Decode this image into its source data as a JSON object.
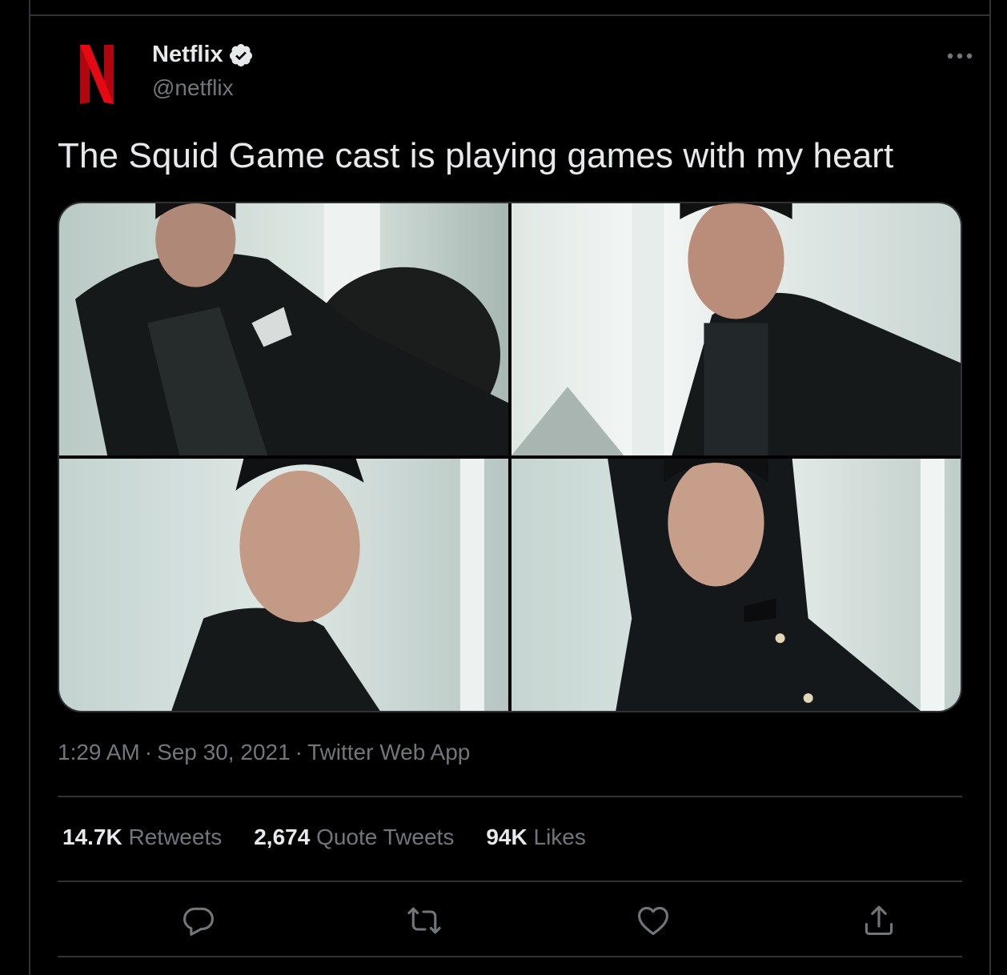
{
  "tweet": {
    "author": {
      "display_name": "Netflix",
      "handle": "@netflix",
      "verified": true,
      "avatar_icon": "netflix-n-logo",
      "brand_color": "#e50914"
    },
    "text": "The Squid Game cast is playing games with my heart",
    "media": [
      {
        "alt": "Cast member in dark suit with pocket square leaning on chair"
      },
      {
        "alt": "Cast member in black suit by window"
      },
      {
        "alt": "Cast member in dark jacket leaning on wall"
      },
      {
        "alt": "Cast member in black jacket with bow"
      }
    ],
    "meta": {
      "time": "1:29 AM",
      "separator": "·",
      "date": "Sep 30, 2021",
      "source": "Twitter Web App"
    },
    "stats": {
      "retweets": {
        "count": "14.7K",
        "label": "Retweets"
      },
      "quotes": {
        "count": "2,674",
        "label": "Quote Tweets"
      },
      "likes": {
        "count": "94K",
        "label": "Likes"
      }
    },
    "actions": {
      "reply_icon": "reply-icon",
      "retweet_icon": "retweet-icon",
      "like_icon": "heart-icon",
      "share_icon": "share-icon"
    }
  },
  "colors": {
    "background": "#000000",
    "text_primary": "#e7e9ea",
    "text_secondary": "#71767b",
    "divider": "#2f3336"
  }
}
